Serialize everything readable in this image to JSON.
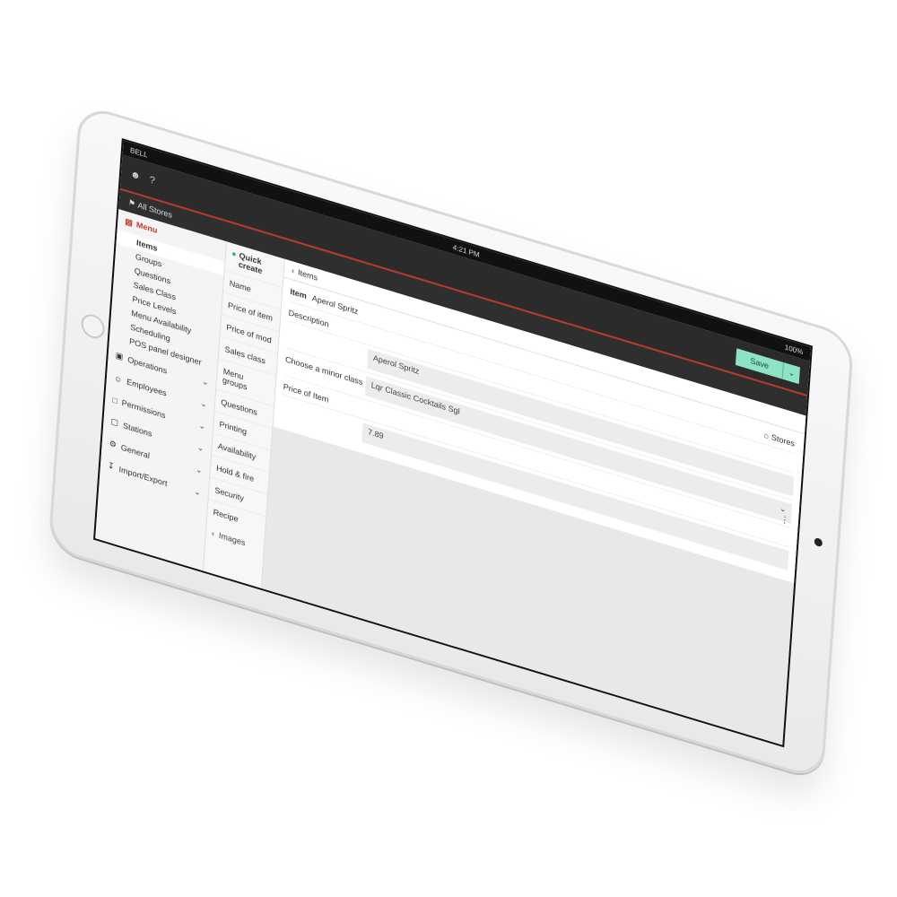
{
  "status": {
    "carrier": "BELL",
    "time": "4:21 PM",
    "battery": "100%"
  },
  "header": {
    "help_icon": "?",
    "user_icon": "user",
    "save_label": "Save",
    "caret": "⌄"
  },
  "store_selector": "All Stores",
  "nav": {
    "menu_label": "Menu",
    "sub_items": [
      "Items",
      "Groups",
      "Questions",
      "Sales Class",
      "Price Levels",
      "Menu Availability",
      "Scheduling",
      "POS panel designer"
    ],
    "sections": [
      "Operations",
      "Employees",
      "Permissions",
      "Stations",
      "General",
      "Import/Export"
    ]
  },
  "subnav": {
    "header": "Quick create",
    "items": [
      "Name",
      "Price of item",
      "Price of mod",
      "Sales class",
      "Menu groups",
      "Questions",
      "Printing",
      "Availability",
      "Hold & fire",
      "Security",
      "Recipe",
      "Images"
    ]
  },
  "main": {
    "breadcrumb": "Items",
    "stores_link": "Stores",
    "item_label": "Item",
    "item_name": "Aperol Spritz",
    "fields": [
      {
        "label": "Description",
        "value": ""
      },
      {
        "label": "",
        "value": "Aperol Spritz"
      },
      {
        "label": "Choose a minor class",
        "value": "Lqr Classic Cocktails Sgl"
      },
      {
        "label": "Price of Item",
        "value": ""
      },
      {
        "label": "",
        "value": "7.89"
      }
    ]
  }
}
